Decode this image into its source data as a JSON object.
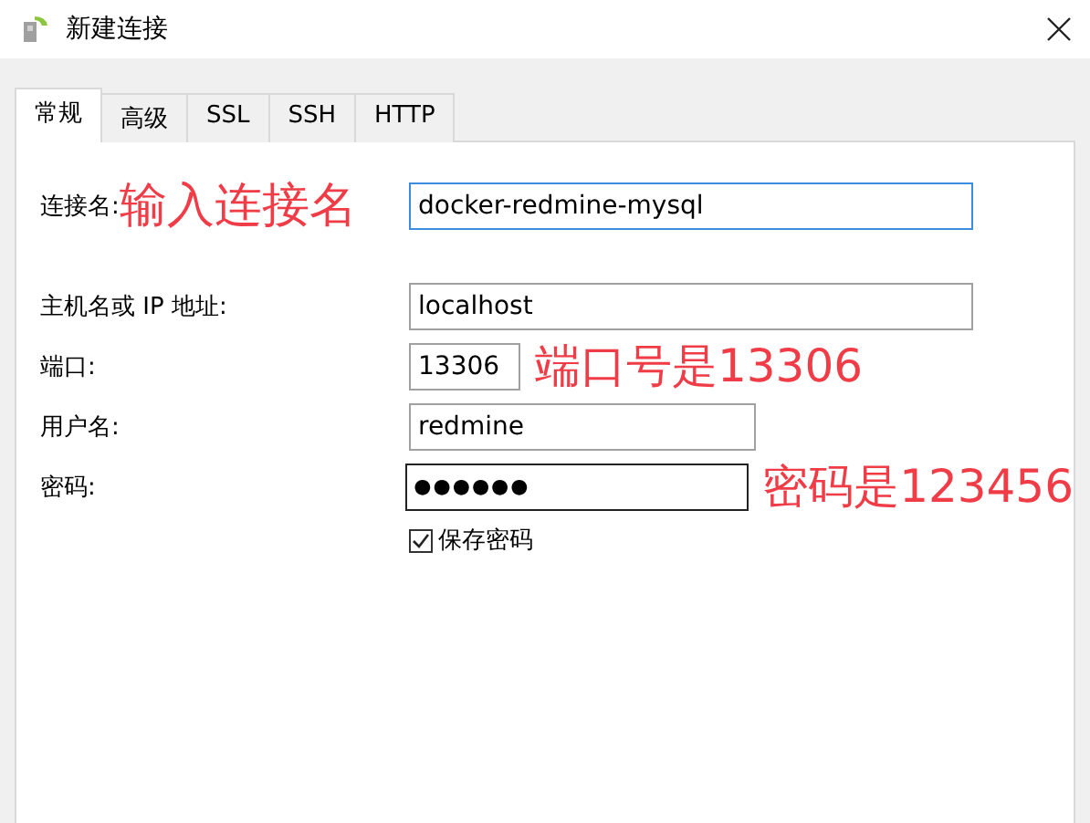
{
  "window": {
    "title": "新建连接"
  },
  "tabs": [
    {
      "label": "常规",
      "selected": true
    },
    {
      "label": "高级",
      "selected": false
    },
    {
      "label": "SSL",
      "selected": false
    },
    {
      "label": "SSH",
      "selected": false
    },
    {
      "label": "HTTP",
      "selected": false
    }
  ],
  "fields": [
    {
      "label": "连接名:",
      "value": "docker-redmine-mysql",
      "focused": true,
      "inline_note": "输入连接名"
    },
    {
      "label": "主机名或 IP 地址:",
      "value": "localhost",
      "focused": false
    },
    {
      "label": "端口:",
      "value": "13306",
      "focused": false,
      "side_note": "端口号是13306"
    },
    {
      "label": "用户名:",
      "value": "redmine",
      "focused": false
    },
    {
      "label": "密码:",
      "value": "●●●●●●",
      "focused": false,
      "side_note": "密码是123456"
    }
  ],
  "save_password": {
    "label": "保存密码",
    "checked": true
  }
}
